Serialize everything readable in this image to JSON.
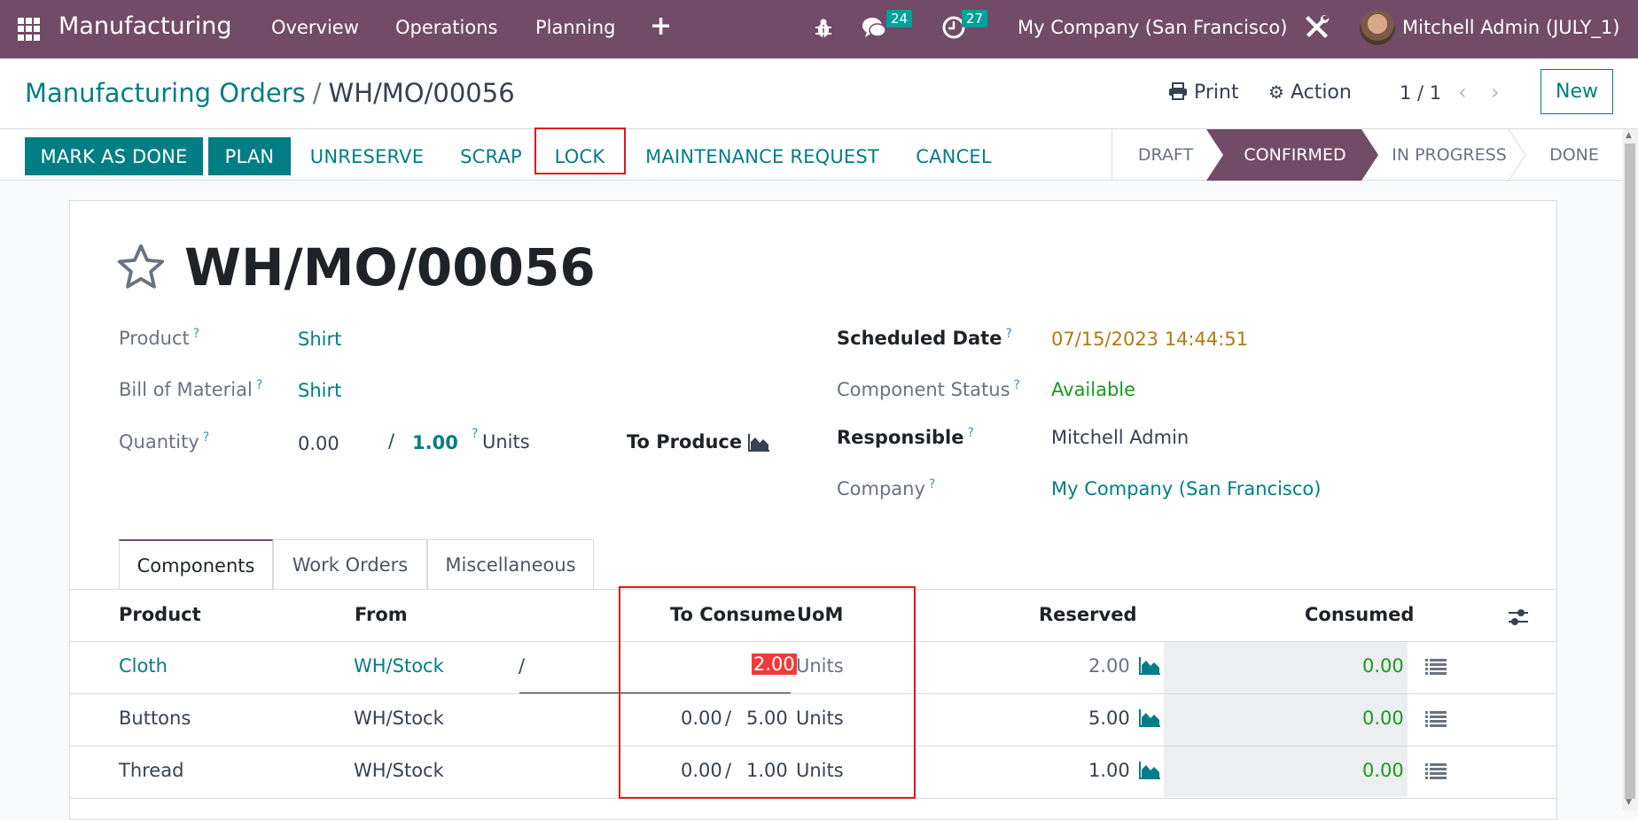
{
  "navbar": {
    "app_name": "Manufacturing",
    "menu": [
      "Overview",
      "Operations",
      "Planning"
    ],
    "messages_count": "24",
    "activities_count": "27",
    "company": "My Company (San Francisco)",
    "user": "Mitchell Admin (JULY_1)",
    "icons": [
      "apps-grid-icon",
      "plus-icon",
      "bug-icon",
      "chat-icon",
      "clock-icon",
      "tools-icon",
      "avatar"
    ]
  },
  "control_panel": {
    "breadcrumb_parent": "Manufacturing Orders",
    "breadcrumb_sep": "/",
    "breadcrumb_current": "WH/MO/00056",
    "print_label": "Print",
    "action_label": "Action",
    "pager": "1 / 1",
    "new_label": "New"
  },
  "status_bar": {
    "buttons": {
      "mark_as_done": "MARK AS DONE",
      "plan": "PLAN",
      "unreserve": "UNRESERVE",
      "scrap": "SCRAP",
      "lock": "LOCK",
      "maintenance_request": "MAINTENANCE REQUEST",
      "cancel": "CANCEL"
    },
    "stages": [
      "DRAFT",
      "CONFIRMED",
      "IN PROGRESS",
      "DONE"
    ],
    "active_stage": "CONFIRMED"
  },
  "form": {
    "title": "WH/MO/00056",
    "help_mark": "?",
    "left": {
      "product_label": "Product",
      "product_value": "Shirt",
      "bom_label": "Bill of Material",
      "bom_value": "Shirt",
      "quantity_label": "Quantity",
      "quantity_produced": "0.00",
      "quantity_sep": "/",
      "quantity_total": "1.00",
      "quantity_uom": "Units",
      "to_produce_label": "To Produce"
    },
    "right": {
      "scheduled_date_label": "Scheduled Date",
      "scheduled_date_value": "07/15/2023 14:44:51",
      "component_status_label": "Component Status",
      "component_status_value": "Available",
      "responsible_label": "Responsible",
      "responsible_value": "Mitchell Admin",
      "company_label": "Company",
      "company_value": "My Company (San Francisco)"
    }
  },
  "tabs": [
    "Components",
    "Work Orders",
    "Miscellaneous"
  ],
  "active_tab": "Components",
  "components_table": {
    "columns": [
      "Product",
      "From",
      "To Consume",
      "UoM",
      "Reserved",
      "Consumed"
    ],
    "rows": [
      {
        "product": "Cloth",
        "from": "WH/Stock",
        "consume_done": "",
        "sep": "/",
        "to_consume": "2.00",
        "uom": "Units",
        "reserved": "2.00",
        "consumed": "0.00",
        "editing": true
      },
      {
        "product": "Buttons",
        "from": "WH/Stock",
        "consume_done": "0.00",
        "sep": "/",
        "to_consume": "5.00",
        "uom": "Units",
        "reserved": "5.00",
        "consumed": "0.00",
        "editing": false
      },
      {
        "product": "Thread",
        "from": "WH/Stock",
        "consume_done": "0.00",
        "sep": "/",
        "to_consume": "1.00",
        "uom": "Units",
        "reserved": "1.00",
        "consumed": "0.00",
        "editing": false
      }
    ]
  },
  "colors": {
    "brand": "#714b67",
    "primary": "#017e84",
    "badge": "#00a09d",
    "highlight": "#e3181a",
    "success": "#179b17",
    "warning": "#b07a12"
  }
}
